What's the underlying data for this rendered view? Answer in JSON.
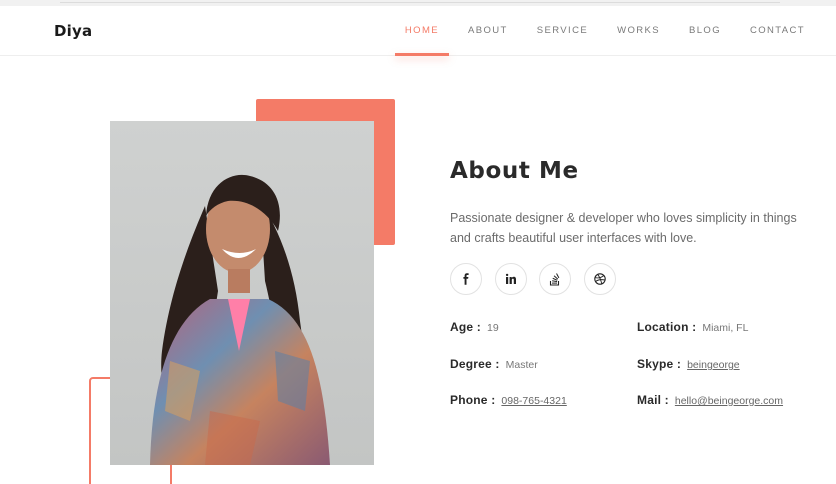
{
  "brand": {
    "name": "Diya"
  },
  "nav": {
    "items": [
      {
        "label": "HOME",
        "active": true
      },
      {
        "label": "ABOUT",
        "active": false
      },
      {
        "label": "SERVICE",
        "active": false
      },
      {
        "label": "WORKS",
        "active": false
      },
      {
        "label": "BLOG",
        "active": false
      },
      {
        "label": "CONTACT",
        "active": false
      }
    ]
  },
  "about": {
    "title": "About Me",
    "description": "Passionate designer & developer who loves simplicity in things and crafts beautiful user interfaces with love."
  },
  "socials": [
    {
      "icon": "facebook-icon"
    },
    {
      "icon": "linkedin-icon"
    },
    {
      "icon": "stackoverflow-icon"
    },
    {
      "icon": "dribbble-icon"
    }
  ],
  "info": {
    "age": {
      "label": "Age :",
      "value": "19"
    },
    "location": {
      "label": "Location :",
      "value": "Miami, FL"
    },
    "degree": {
      "label": "Degree :",
      "value": "Master"
    },
    "skype": {
      "label": "Skype :",
      "value": "beingeorge"
    },
    "phone": {
      "label": "Phone :",
      "value": "098-765-4321"
    },
    "mail": {
      "label": "Mail :",
      "value": "hello@beingeorge.com"
    }
  },
  "colors": {
    "accent": "#f47b67",
    "text": "#2a2a2a",
    "muted": "#6b6b6b"
  }
}
